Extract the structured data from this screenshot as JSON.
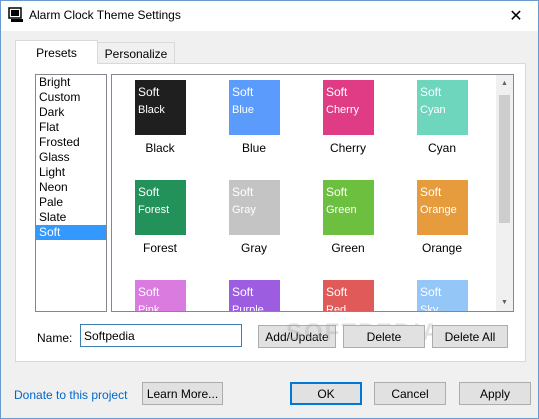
{
  "window": {
    "title": "Alarm Clock Theme Settings",
    "close_glyph": "✕",
    "accent": "#0078d7"
  },
  "tabs": [
    {
      "label": "Presets",
      "active": true
    },
    {
      "label": "Personalize",
      "active": false
    }
  ],
  "presets": {
    "items": [
      "Bright",
      "Custom",
      "Dark",
      "Flat",
      "Frosted",
      "Glass",
      "Light",
      "Neon",
      "Pale",
      "Slate",
      "Soft"
    ],
    "selected": "Soft"
  },
  "themes": [
    {
      "line1": "Soft",
      "line2": "Black",
      "label": "Black",
      "color": "#1f1f1f"
    },
    {
      "line1": "Soft",
      "line2": "Blue",
      "label": "Blue",
      "color": "#5b9bfb"
    },
    {
      "line1": "Soft",
      "line2": "Cherry",
      "label": "Cherry",
      "color": "#df3c85"
    },
    {
      "line1": "Soft",
      "line2": "Cyan",
      "label": "Cyan",
      "color": "#6dd6bd"
    },
    {
      "line1": "Soft",
      "line2": "Forest",
      "label": "Forest",
      "color": "#22915a"
    },
    {
      "line1": "Soft",
      "line2": "Gray",
      "label": "Gray",
      "color": "#c4c4c4"
    },
    {
      "line1": "Soft",
      "line2": "Green",
      "label": "Green",
      "color": "#6dc03f"
    },
    {
      "line1": "Soft",
      "line2": "Orange",
      "label": "Orange",
      "color": "#e69c3c"
    },
    {
      "line1": "Soft",
      "line2": "Pink",
      "label": "",
      "color": "#d97bdf"
    },
    {
      "line1": "Soft",
      "line2": "Purple",
      "label": "",
      "color": "#9c5de0"
    },
    {
      "line1": "Soft",
      "line2": "Red",
      "label": "",
      "color": "#e05a5a"
    },
    {
      "line1": "Soft",
      "line2": "Sky",
      "label": "",
      "color": "#94c6f7"
    }
  ],
  "form": {
    "name_label": "Name:",
    "name_value": "Softpedia"
  },
  "buttons": {
    "add_update": "Add/Update",
    "delete": "Delete",
    "delete_all": "Delete All",
    "learn_more": "Learn More...",
    "ok": "OK",
    "cancel": "Cancel",
    "apply": "Apply"
  },
  "donate_link": "Donate to this project",
  "watermark": "SOFTPEDIA"
}
